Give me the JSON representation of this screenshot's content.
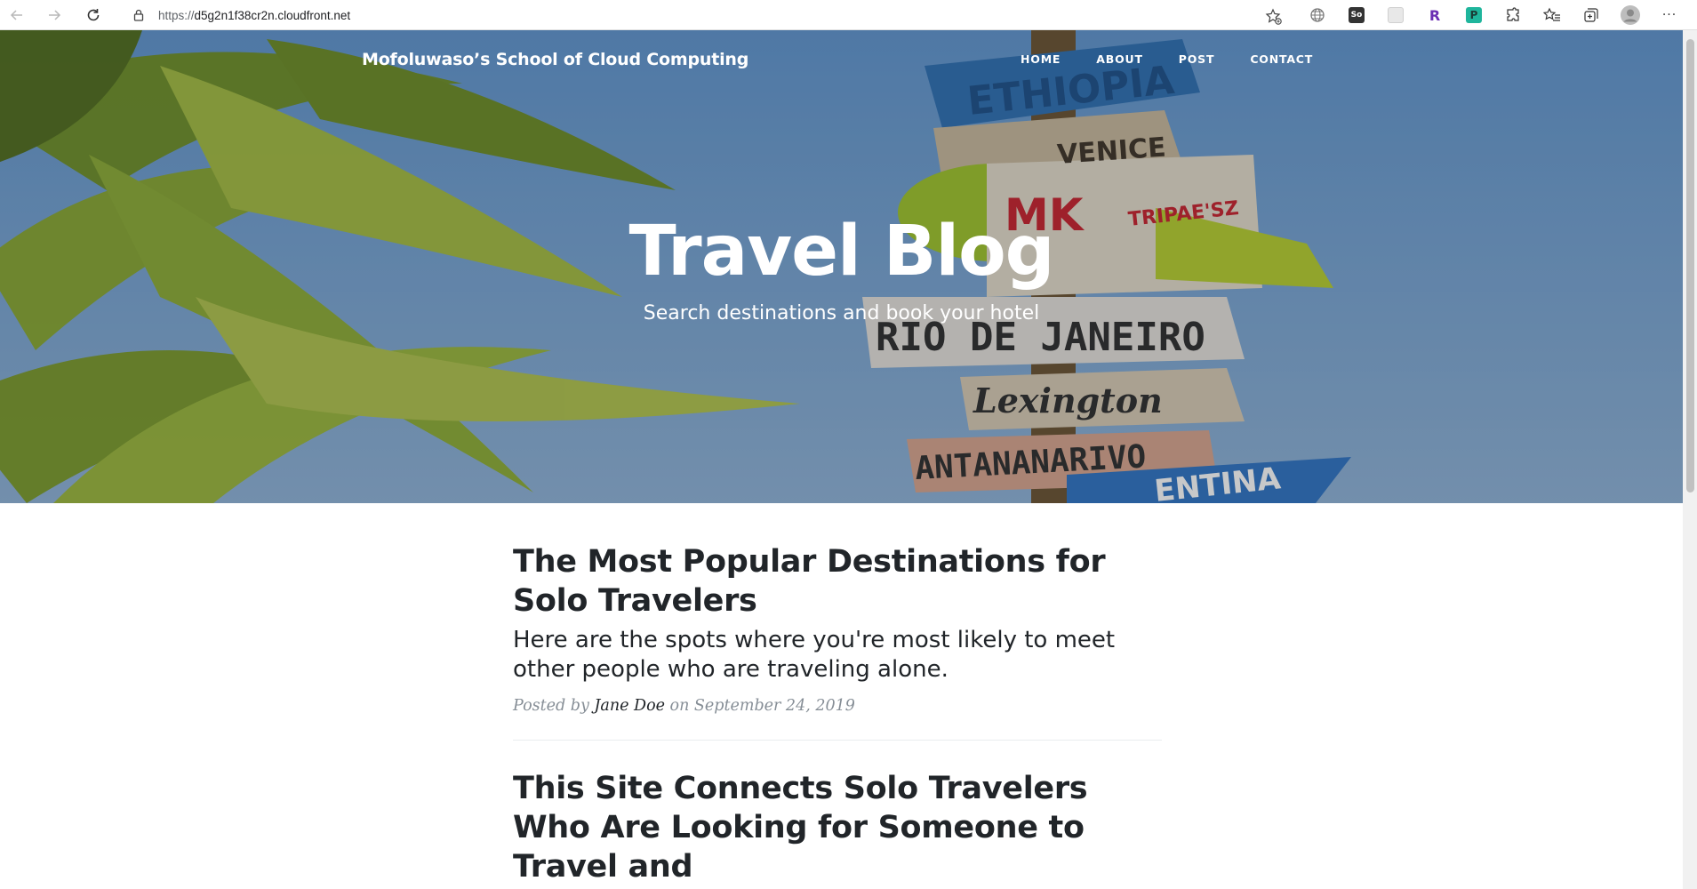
{
  "browser": {
    "url_scheme": "https://",
    "url_host": "d5g2n1f38cr2n.cloudfront.net",
    "extensions": [
      {
        "icon": "globe-icon",
        "label": ""
      },
      {
        "icon": "seo-extension-icon",
        "label": "So"
      },
      {
        "icon": "extension-placeholder-icon",
        "label": ""
      },
      {
        "icon": "r-extension-icon",
        "label": "R"
      },
      {
        "icon": "p-extension-icon",
        "label": "P"
      },
      {
        "icon": "puzzle-extensions-icon",
        "label": ""
      },
      {
        "icon": "favorites-icon",
        "label": ""
      },
      {
        "icon": "collections-icon",
        "label": ""
      },
      {
        "icon": "profile-avatar-icon",
        "label": ""
      },
      {
        "icon": "more-menu-icon",
        "label": "···"
      }
    ]
  },
  "site": {
    "brand": "Mofoluwaso’s School of Cloud Computing",
    "nav": [
      "HOME",
      "ABOUT",
      "POST",
      "CONTACT"
    ]
  },
  "hero": {
    "title": "Travel Blog",
    "subtitle": "Search destinations and book your hotel",
    "sign_texts": [
      "ETHIOPIA",
      "VENICE",
      "MK",
      "TRIPAE'SZ",
      "RIO DE JANEIRO",
      "Lexington",
      "ANTANANARIVO",
      "ENTINA"
    ]
  },
  "posts": [
    {
      "title": "The Most Popular Destinations for Solo Travelers",
      "subtitle": "Here are the spots where you're most likely to meet other people who are traveling alone.",
      "meta_prefix": "Posted by",
      "author": "Jane Doe",
      "meta_on": "on September 24, 2019"
    },
    {
      "title": "This Site Connects Solo Travelers Who Are Looking for Someone to Travel and"
    }
  ],
  "colors": {
    "heading": "#212529",
    "meta": "#868e96",
    "hero_sky": "#7fa8d4"
  }
}
